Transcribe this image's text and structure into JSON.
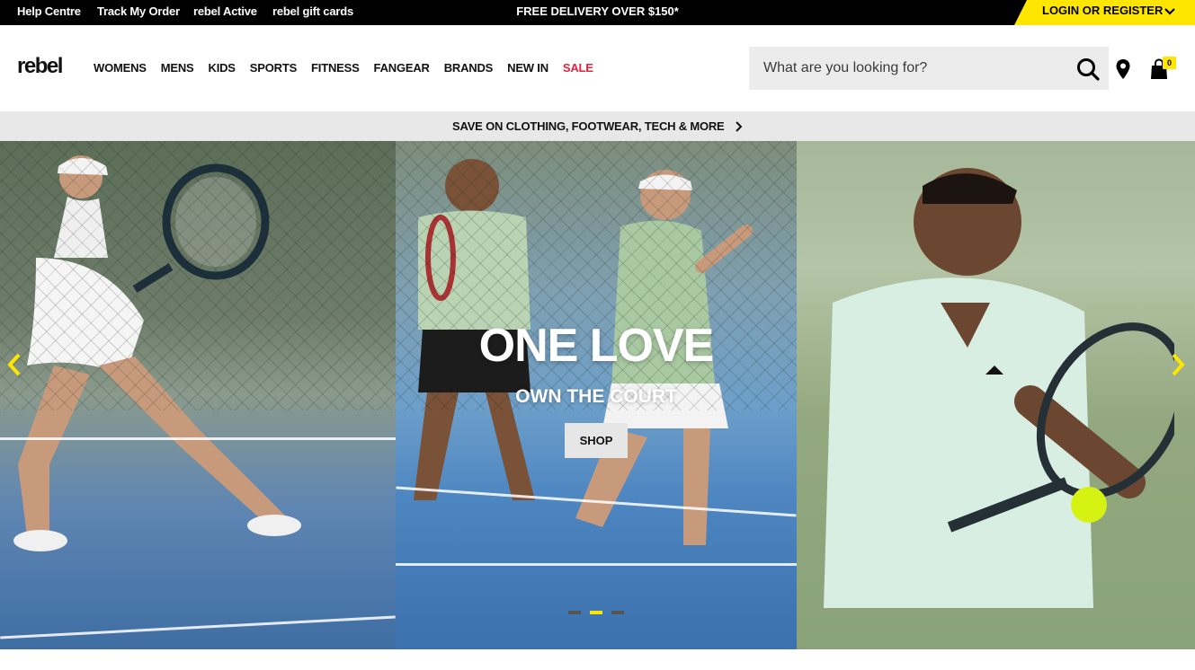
{
  "topbar": {
    "links": [
      "Help Centre",
      "Track My Order",
      "rebel Active",
      "rebel gift cards"
    ],
    "promo": "FREE DELIVERY OVER $150*",
    "login": "LOGIN OR REGISTER"
  },
  "header": {
    "logo": "rebel",
    "nav": [
      "WOMENS",
      "MENS",
      "KIDS",
      "SPORTS",
      "FITNESS",
      "FANGEAR",
      "BRANDS",
      "NEW IN",
      "SALE"
    ],
    "search_placeholder": "What are you looking for?",
    "bag_count": "0"
  },
  "strip": {
    "text": "SAVE ON CLOTHING, FOOTWEAR, TECH & MORE"
  },
  "hero": {
    "title": "ONE LOVE",
    "subtitle": "OWN THE COURT",
    "cta": "SHOP",
    "slides": 3,
    "active_slide": 2
  },
  "colors": {
    "accent": "#ffe600",
    "sale": "#e5243b",
    "topbar": "#000000"
  },
  "icons": [
    "search-icon",
    "store-locator-icon",
    "shopping-bag-icon",
    "chevron-down-icon",
    "chevron-right-icon",
    "arrow-left-icon",
    "arrow-right-icon"
  ]
}
